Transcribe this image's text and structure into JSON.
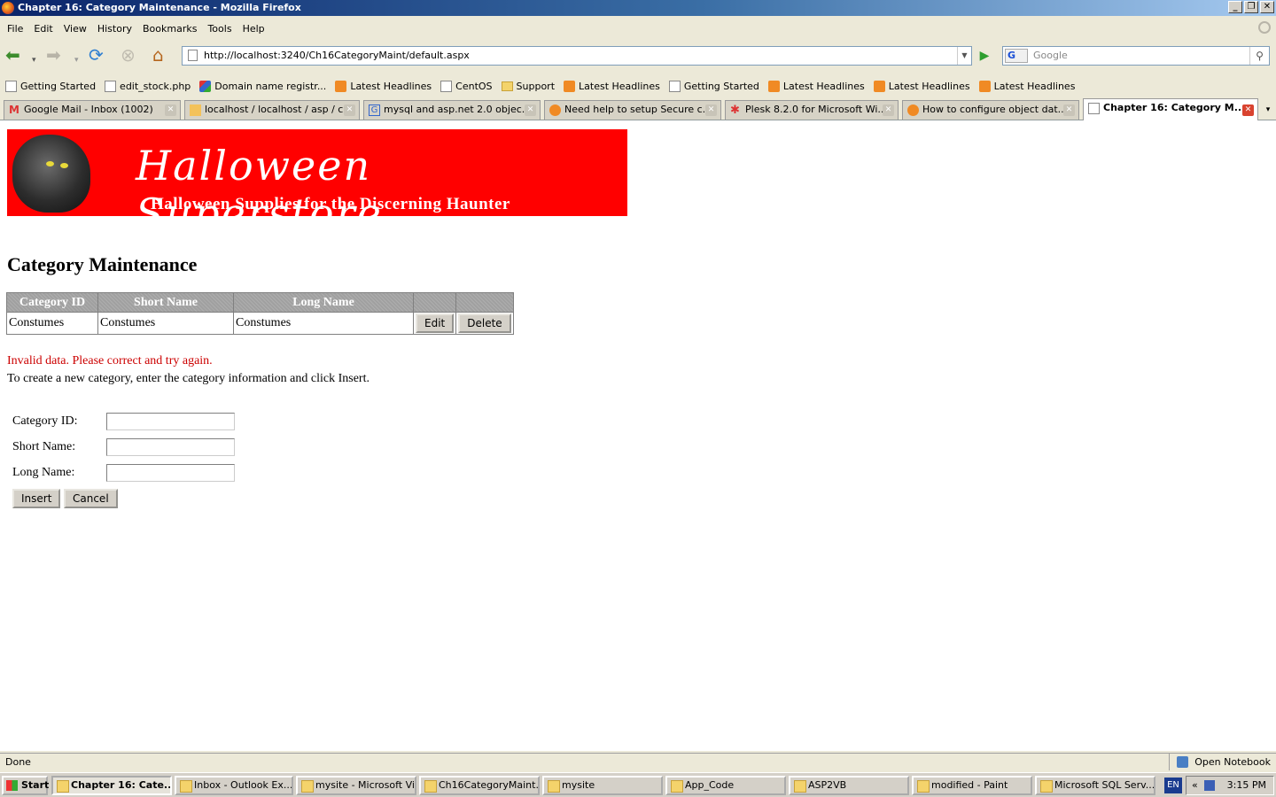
{
  "window": {
    "title": "Chapter 16: Category Maintenance - Mozilla Firefox",
    "minimize": "_",
    "restore": "❐",
    "close": "✕"
  },
  "menu": [
    "File",
    "Edit",
    "View",
    "History",
    "Bookmarks",
    "Tools",
    "Help"
  ],
  "nav": {
    "url": "http://localhost:3240/Ch16CategoryMaint/default.aspx",
    "search_placeholder": "Google",
    "search_engine": "G"
  },
  "bookmarks": [
    {
      "label": "Getting Started",
      "icon": "page-icon"
    },
    {
      "label": "edit_stock.php",
      "icon": "page-icon"
    },
    {
      "label": "Domain name registr...",
      "icon": "multicolor-icon"
    },
    {
      "label": "Latest Headlines",
      "icon": "rss-icon"
    },
    {
      "label": "CentOS",
      "icon": "page-icon"
    },
    {
      "label": "Support",
      "icon": "folder-icon"
    },
    {
      "label": "Latest Headlines",
      "icon": "rss-icon"
    },
    {
      "label": "Getting Started",
      "icon": "page-icon"
    },
    {
      "label": "Latest Headlines",
      "icon": "rss-icon"
    },
    {
      "label": "Latest Headlines",
      "icon": "rss-icon"
    },
    {
      "label": "Latest Headlines",
      "icon": "rss-icon"
    }
  ],
  "tabs": [
    {
      "label": "Google Mail - Inbox (1002)"
    },
    {
      "label": "localhost / localhost / asp / c..."
    },
    {
      "label": "mysql and asp.net 2.0 objec..."
    },
    {
      "label": "Need help to setup Secure c..."
    },
    {
      "label": "Plesk 8.2.0 for Microsoft Wi..."
    },
    {
      "label": "How to configure object dat..."
    },
    {
      "label": "Chapter 16: Category M..."
    }
  ],
  "banner": {
    "title": "Halloween Superstore",
    "subtitle": "Halloween Supplies for the Discerning Haunter"
  },
  "page": {
    "heading": "Category Maintenance",
    "error": "Invalid data. Please correct and try again.",
    "instructions": "To create a new category, enter the category information and click Insert."
  },
  "grid": {
    "headers": [
      "Category ID",
      "Short Name",
      "Long Name"
    ],
    "rows": [
      {
        "id": "Constumes",
        "short": "Constumes",
        "long": "Constumes"
      }
    ],
    "edit_label": "Edit",
    "delete_label": "Delete"
  },
  "form": {
    "category_id_label": "Category ID:",
    "short_name_label": "Short Name:",
    "long_name_label": "Long Name:",
    "category_id_value": "",
    "short_name_value": "",
    "long_name_value": "",
    "insert_label": "Insert",
    "cancel_label": "Cancel"
  },
  "status": {
    "text": "Done",
    "notebook": "Open Notebook"
  },
  "taskbar": {
    "start": "Start",
    "tasks": [
      "Chapter 16: Cate...",
      "Inbox - Outlook Ex...",
      "mysite - Microsoft Vi...",
      "Ch16CategoryMaint...",
      "mysite",
      "App_Code",
      "ASP2VB",
      "modified - Paint",
      "Microsoft SQL Serv..."
    ],
    "lang": "EN",
    "clock": "3:15 PM"
  },
  "colors": {
    "banner_bg": "#ff0000",
    "error_text": "#cc0000",
    "grid_header_bg": "#a0a0a0"
  }
}
